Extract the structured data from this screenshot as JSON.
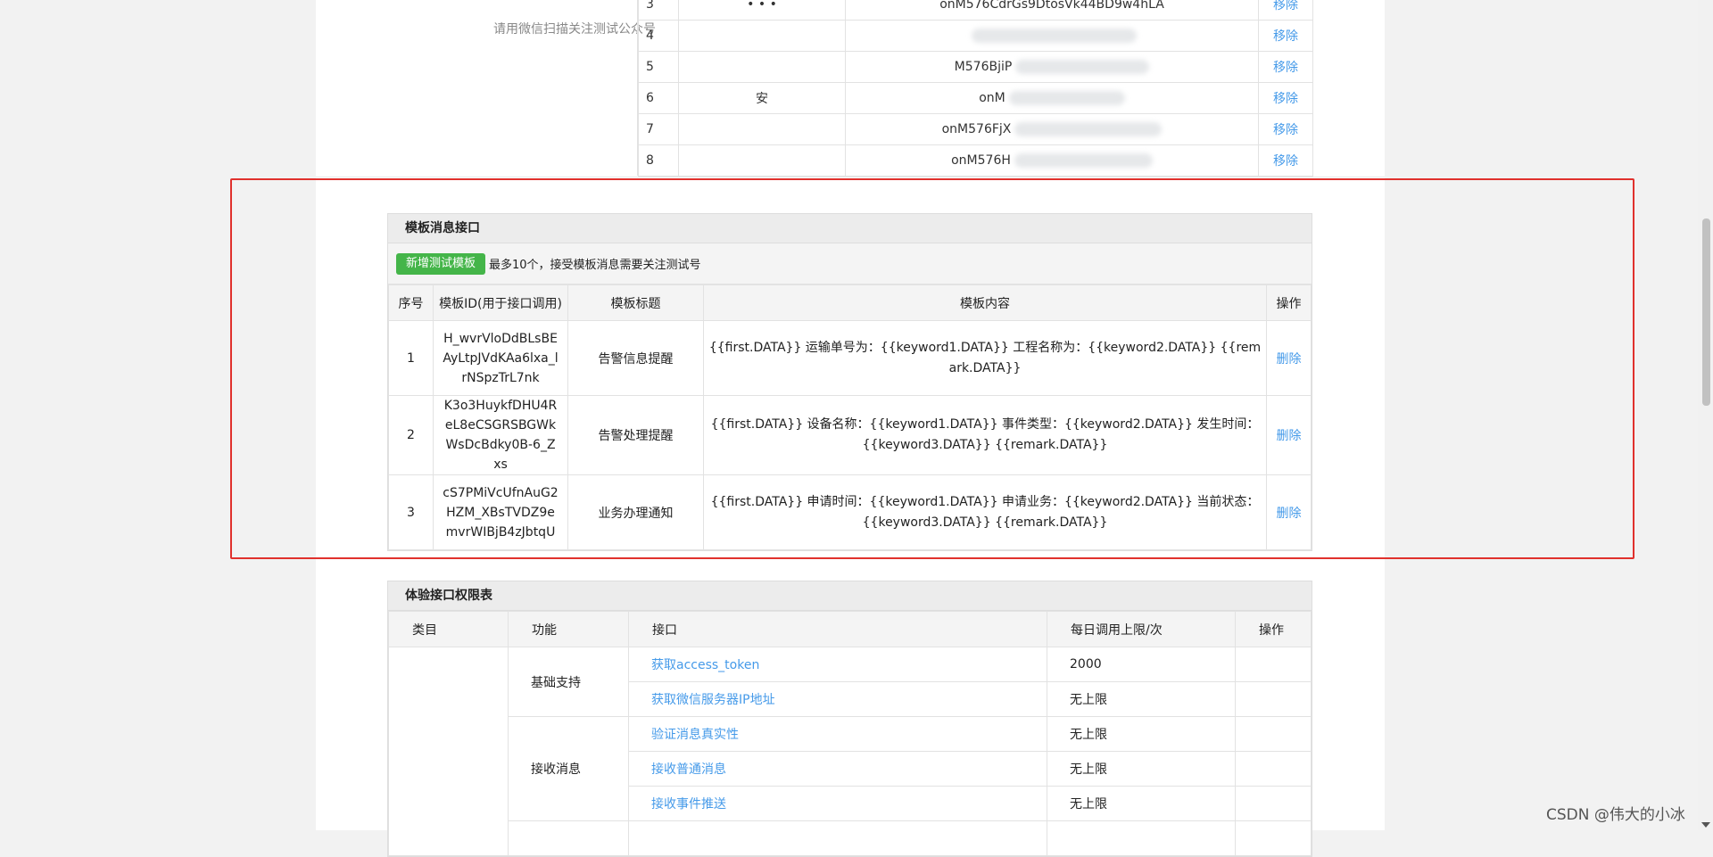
{
  "fans": {
    "left_note": "请用微信扫描关注测试公众号",
    "remove_label": "移除",
    "rows": [
      {
        "idx": "3",
        "nickname": "• • •",
        "openid": "onM576CdrGs9DtosVk44BD9w4hLA"
      },
      {
        "idx": "4",
        "nickname": "",
        "openid": ""
      },
      {
        "idx": "5",
        "nickname": "",
        "openid": "M576BjiP"
      },
      {
        "idx": "6",
        "nickname": "安",
        "openid": "onM"
      },
      {
        "idx": "7",
        "nickname": "",
        "openid": "onM576FjX"
      },
      {
        "idx": "8",
        "nickname": "",
        "openid": "onM576H"
      }
    ]
  },
  "template_panel": {
    "title": "模板消息接口",
    "add_button": "新增测试模板",
    "note": "最多10个，接受模板消息需要关注测试号",
    "headers": [
      "序号",
      "模板ID(用于接口调用)",
      "模板标题",
      "模板内容",
      "操作"
    ],
    "delete_label": "删除",
    "rows": [
      {
        "idx": "1",
        "id": "H_wvrVloDdBLsBEAyLtpJVdKAa6lxa_lrNSpzTrL7nk",
        "title": "告警信息提醒",
        "content": "{{first.DATA}} 运输单号为：{{keyword1.DATA}} 工程名称为：{{keyword2.DATA}} {{remark.DATA}}"
      },
      {
        "idx": "2",
        "id": "K3o3HuykfDHU4ReL8eCSGRSBGWkWsDcBdky0B-6_Zxs",
        "title": "告警处理提醒",
        "content": "{{first.DATA}} 设备名称：{{keyword1.DATA}} 事件类型：{{keyword2.DATA}} 发生时间：{{keyword3.DATA}} {{remark.DATA}}"
      },
      {
        "idx": "3",
        "id": "cS7PMiVcUfnAuG2HZM_XBsTVDZ9emvrWIBjB4zJbtqU",
        "title": "业务办理通知",
        "content": "{{first.DATA}} 申请时间：{{keyword1.DATA}} 申请业务：{{keyword2.DATA}} 当前状态：{{keyword3.DATA}} {{remark.DATA}}"
      }
    ]
  },
  "perm_panel": {
    "title": "体验接口权限表",
    "headers": [
      "类目",
      "功能",
      "接口",
      "每日调用上限/次",
      "操作"
    ],
    "groups": [
      {
        "func": "基础支持",
        "rows": [
          {
            "api": "获取access_token",
            "limit": "2000"
          },
          {
            "api": "获取微信服务器IP地址",
            "limit": "无上限"
          }
        ]
      },
      {
        "func": "接收消息",
        "rows": [
          {
            "api": "验证消息真实性",
            "limit": "无上限"
          },
          {
            "api": "接收普通消息",
            "limit": "无上限"
          },
          {
            "api": "接收事件推送",
            "limit": "无上限"
          }
        ]
      }
    ]
  },
  "watermark": "CSDN @伟大的小冰",
  "colors": {
    "link": "#459ae9",
    "green_button": "#44b549",
    "highlight_border": "#e0312d"
  }
}
